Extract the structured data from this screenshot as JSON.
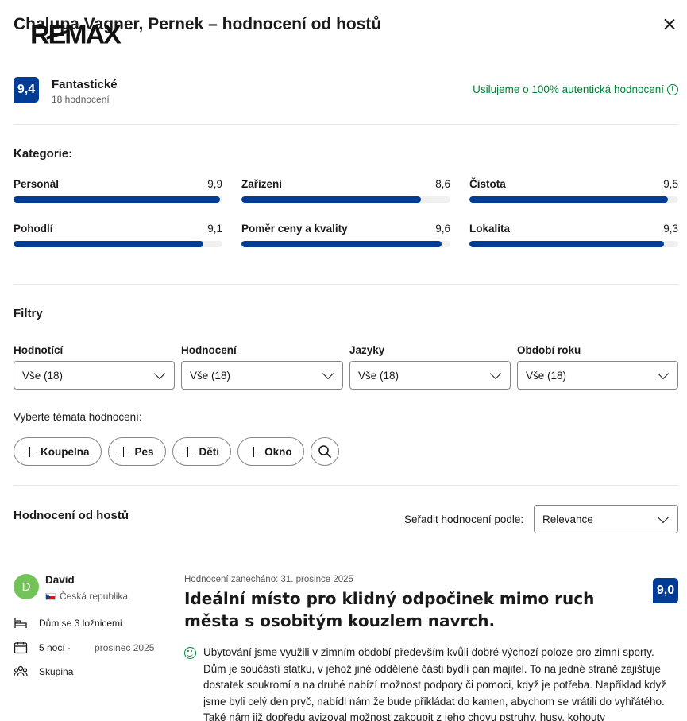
{
  "header": {
    "title": "Chalupa Vagner, Pernek – hodnocení od hostů",
    "logo_text": "RE/MAX"
  },
  "overall": {
    "score": "9,4",
    "label": "Fantastické",
    "count": "18 hodnocení",
    "authentic_text": "Usilujeme o 100% autentická hodnocení"
  },
  "categories": {
    "title": "Kategorie:",
    "items": [
      {
        "name": "Personál",
        "score": "9,9",
        "value": 9.9
      },
      {
        "name": "Zařízení",
        "score": "8,6",
        "value": 8.6
      },
      {
        "name": "Čistota",
        "score": "9,5",
        "value": 9.5
      },
      {
        "name": "Pohodlí",
        "score": "9,1",
        "value": 9.1
      },
      {
        "name": "Poměr ceny a kvality",
        "score": "9,6",
        "value": 9.6
      },
      {
        "name": "Lokalita",
        "score": "9,3",
        "value": 9.3
      }
    ]
  },
  "filters": {
    "title": "Filtry",
    "items": [
      {
        "label": "Hodnotící",
        "value": "Vše (18)"
      },
      {
        "label": "Hodnocení",
        "value": "Vše (18)"
      },
      {
        "label": "Jazyky",
        "value": "Vše (18)"
      },
      {
        "label": "Období roku",
        "value": "Vše (18)"
      }
    ],
    "topics_label": "Vyberte témata hodnocení:",
    "topics": [
      "Koupelna",
      "Pes",
      "Děti",
      "Okno"
    ]
  },
  "reviews": {
    "title": "Hodnocení od hostů",
    "sort_label": "Seřadit hodnocení podle:",
    "sort_value": "Relevance",
    "first": {
      "avatar_letter": "D",
      "name": "David",
      "country": "Česká republika",
      "room": "Dům se 3 ložnicemi",
      "nights": "5 nocí ·",
      "stay_date": "prosinec 2025",
      "traveler_type": "Skupina",
      "date": "Hodnocení zanecháno: 31. prosince 2025",
      "title": "Ideální místo pro klidný odpočinek mimo ruch města s osobitým kouzlem navrch.",
      "score": "9,0",
      "text": "Ubytování jsme využili v zimním období především kvůli dobré výchozí poloze pro zimní sporty. Dům je součástí statku, v jehož jiné oddělené části bydlí pan majitel. To na jedné straně zajišťuje dostatek soukromí a na druhé nabízí možnost podpory či pomoci, když je potřeba. Například když jsme byli celý den pryč, nabídl nám že bude přikládat do kamen, abychom se vrátili do vyhřátého. Také nám již dopředu avizoval možnost zakoupit z jeho chovu pstruhy, husy, kohouty"
    }
  },
  "colors": {
    "brand": "#003b95",
    "positive": "#008234",
    "avatar": "#73c359"
  }
}
